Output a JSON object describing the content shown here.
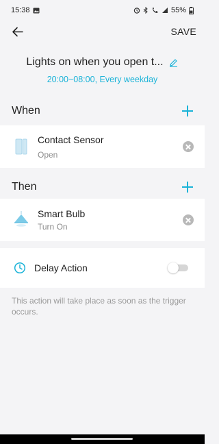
{
  "status_bar": {
    "time": "15:38",
    "battery": "55%",
    "icons": [
      "gallery-icon",
      "alarm-icon",
      "bluetooth-icon",
      "wifi-call-icon",
      "signal-icon",
      "battery-icon"
    ]
  },
  "header": {
    "back_icon": "arrow-left-icon",
    "save_label": "SAVE"
  },
  "automation": {
    "title": "Lights on when you open t...",
    "schedule": "20:00~08:00, Every weekday"
  },
  "when": {
    "label": "When",
    "device": {
      "name": "Contact Sensor",
      "state": "Open",
      "icon": "contact-sensor-icon"
    }
  },
  "then": {
    "label": "Then",
    "device": {
      "name": "Smart Bulb",
      "state": "Turn On",
      "icon": "lamp-icon"
    }
  },
  "delay": {
    "label": "Delay Action",
    "enabled": false
  },
  "footnote": "This action will take place as soon as the trigger occurs.",
  "colors": {
    "accent": "#1ab3d8",
    "background": "#f4f4f6"
  }
}
